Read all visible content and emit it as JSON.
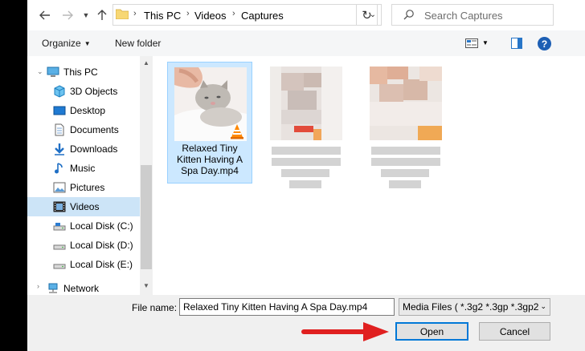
{
  "address": {
    "crumbs": [
      "This PC",
      "Videos",
      "Captures"
    ],
    "search_placeholder": "Search Captures"
  },
  "toolbar": {
    "organize_label": "Organize",
    "new_folder_label": "New folder"
  },
  "nav": {
    "items": [
      {
        "label": "This PC",
        "icon": "computer-icon"
      },
      {
        "label": "3D Objects",
        "icon": "cube-icon"
      },
      {
        "label": "Desktop",
        "icon": "desktop-icon"
      },
      {
        "label": "Documents",
        "icon": "document-icon"
      },
      {
        "label": "Downloads",
        "icon": "download-icon"
      },
      {
        "label": "Music",
        "icon": "music-icon"
      },
      {
        "label": "Pictures",
        "icon": "pictures-icon"
      },
      {
        "label": "Videos",
        "icon": "video-icon",
        "selected": true
      },
      {
        "label": "Local Disk (C:)",
        "icon": "drive-icon"
      },
      {
        "label": "Local Disk (D:)",
        "icon": "drive-icon"
      },
      {
        "label": "Local Disk (E:)",
        "icon": "drive-icon"
      },
      {
        "label": "Network",
        "icon": "network-icon"
      }
    ]
  },
  "files": {
    "selected_name": "Relaxed Tiny Kitten Having A Spa Day.mp4"
  },
  "bottom": {
    "file_name_label": "File name:",
    "file_name_value": "Relaxed Tiny Kitten Having A Spa Day.mp4",
    "filter_value": "Media Files ( *.3g2 *.3gp *.3gp2",
    "open_label": "Open",
    "cancel_label": "Cancel"
  },
  "colors": {
    "selection": "#cce8ff",
    "accent": "#0078d7",
    "annotation_arrow": "#e02020"
  }
}
